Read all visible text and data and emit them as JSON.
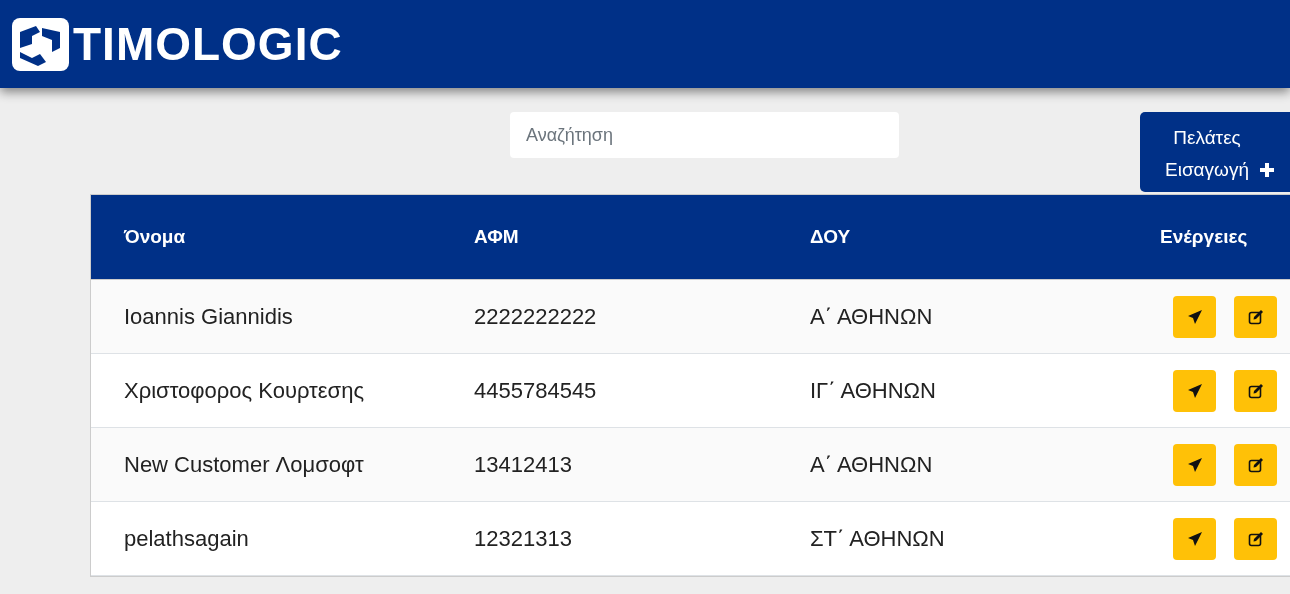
{
  "header": {
    "brand": "TIMOLOGIC"
  },
  "search": {
    "placeholder": "Αναζήτηση"
  },
  "add_button": {
    "label": "Πελάτες Εισαγωγή"
  },
  "table": {
    "columns": [
      "Όνομα",
      "ΑΦΜ",
      "ΔΟΥ",
      "Ενέργειες"
    ],
    "rows": [
      {
        "name": "Ioannis Giannidis",
        "afm": "2222222222",
        "doy": "Α΄ ΑΘΗΝΩΝ"
      },
      {
        "name": "Χριστοφορος Κουρτεσης",
        "afm": "4455784545",
        "doy": "ΙΓ΄ ΑΘΗΝΩΝ"
      },
      {
        "name": "New Customer Λομσοφτ",
        "afm": "13412413",
        "doy": "Α΄ ΑΘΗΝΩΝ"
      },
      {
        "name": "pelathsagain",
        "afm": "12321313",
        "doy": "ΣΤ΄ ΑΘΗΝΩΝ"
      }
    ]
  }
}
